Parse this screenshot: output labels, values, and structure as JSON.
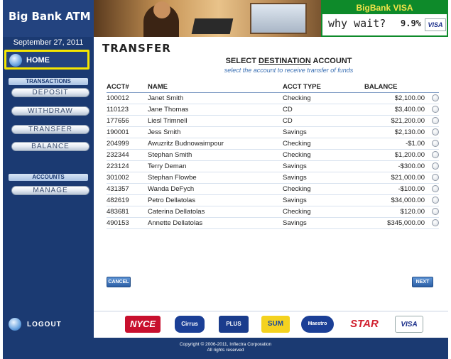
{
  "app": {
    "brand": "Big Bank ATM"
  },
  "promo": {
    "title": "BigBank VISA",
    "tagline": "why wait?",
    "rate": "9.9%",
    "card": "VISA"
  },
  "sidebar": {
    "date": "September 27, 2011",
    "home_label": "HOME",
    "transactions_header": "TRANSACTIONS",
    "transactions": [
      "DEPOSIT",
      "WITHDRAW",
      "TRANSFER",
      "BALANCE"
    ],
    "accounts_header": "ACCOUNTS",
    "accounts": [
      "MANAGE"
    ]
  },
  "main": {
    "title": "TRANSFER",
    "select_prefix": "SELECT",
    "select_emph": "DESTINATION",
    "select_suffix": "ACCOUNT",
    "subtitle": "select the account to receive transfer of funds",
    "columns": {
      "acct": "ACCT#",
      "name": "NAME",
      "type": "ACCT TYPE",
      "balance": "BALANCE"
    },
    "rows": [
      {
        "acct": "100012",
        "name": "Janet Smith",
        "type": "Checking",
        "balance": "$2,100.00"
      },
      {
        "acct": "110123",
        "name": "Jane Thomas",
        "type": "CD",
        "balance": "$3,400.00"
      },
      {
        "acct": "177656",
        "name": "Liesl Trimnell",
        "type": "CD",
        "balance": "$21,200.00"
      },
      {
        "acct": "190001",
        "name": "Jess Smith",
        "type": "Savings",
        "balance": "$2,130.00"
      },
      {
        "acct": "204999",
        "name": "Awuzritz Budnowaimpour",
        "type": "Checking",
        "balance": "-$1.00"
      },
      {
        "acct": "232344",
        "name": "Stephan Smith",
        "type": "Checking",
        "balance": "$1,200.00"
      },
      {
        "acct": "223124",
        "name": "Terry Deman",
        "type": "Savings",
        "balance": "-$300.00"
      },
      {
        "acct": "301002",
        "name": "Stephan Flowbe",
        "type": "Savings",
        "balance": "$21,000.00"
      },
      {
        "acct": "431357",
        "name": "Wanda DeFych",
        "type": "Checking",
        "balance": "-$100.00"
      },
      {
        "acct": "482619",
        "name": "Petro Dellatolas",
        "type": "Savings",
        "balance": "$34,000.00"
      },
      {
        "acct": "483681",
        "name": "Caterina Dellatolas",
        "type": "Checking",
        "balance": "$120.00"
      },
      {
        "acct": "490153",
        "name": "Annette Dellatolas",
        "type": "Savings",
        "balance": "$345,000.00"
      }
    ],
    "cancel_label": "CANCEL",
    "next_label": "NEXT"
  },
  "footer": {
    "logout_label": "LOGOUT",
    "logos": [
      "NYCE",
      "Cirrus",
      "PLUS",
      "SUM",
      "Maestro",
      "STAR",
      "VISA"
    ],
    "copyright_line1": "Copyright © 2006-2011, Inflectra Corporation",
    "copyright_line2": "All rights reserved"
  },
  "colors": {
    "frame_navy": "#1b3a72",
    "home_highlight": "#f5e600",
    "promo_green": "#0e8a2a",
    "promo_yellow": "#f2e34a",
    "subtitle_blue": "#3a6fb3",
    "button_blue": "#2c5fa5"
  }
}
